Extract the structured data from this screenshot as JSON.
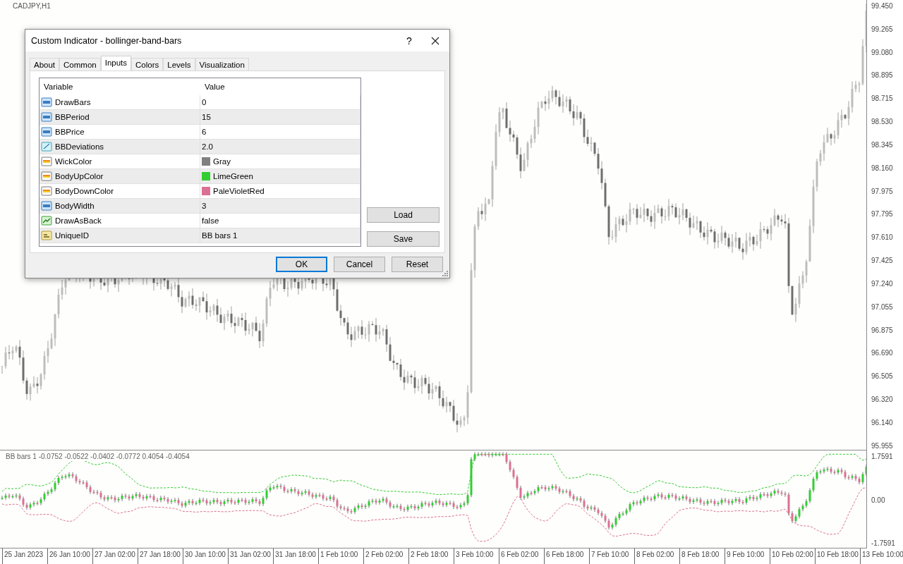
{
  "chart": {
    "symbol": "CADJPY,H1",
    "price_axis": [
      "99.450",
      "99.265",
      "99.080",
      "98.895",
      "98.715",
      "98.530",
      "98.345",
      "98.160",
      "97.975",
      "97.795",
      "97.610",
      "97.425",
      "97.240",
      "97.055",
      "96.875",
      "96.690",
      "96.505",
      "96.320",
      "96.140",
      "95.955"
    ],
    "indicator_label": "BB bars 1 -0.0752 -0.0522 -0.0402 -0.0772 0.4054 -0.4054",
    "indicator_axis": [
      "1.7591",
      "0.00",
      "-1.7591"
    ],
    "time_axis": [
      "25 Jan 2023",
      "26 Jan 10:00",
      "27 Jan 02:00",
      "27 Jan 18:00",
      "30 Jan 10:00",
      "31 Jan 02:00",
      "31 Jan 18:00",
      "1 Feb 10:00",
      "2 Feb 02:00",
      "2 Feb 18:00",
      "3 Feb 10:00",
      "6 Feb 02:00",
      "6 Feb 18:00",
      "7 Feb 10:00",
      "8 Feb 02:00",
      "8 Feb 18:00",
      "9 Feb 10:00",
      "10 Feb 02:00",
      "10 Feb 18:00",
      "13 Feb 10:00"
    ]
  },
  "dialog": {
    "title": "Custom Indicator - bollinger-band-bars",
    "help": "?",
    "tabs": [
      {
        "label": "About",
        "selected": false
      },
      {
        "label": "Common",
        "selected": false
      },
      {
        "label": "Inputs",
        "selected": true
      },
      {
        "label": "Colors",
        "selected": false
      },
      {
        "label": "Levels",
        "selected": false
      },
      {
        "label": "Visualization",
        "selected": false
      }
    ],
    "columns": [
      "Variable",
      "Value"
    ],
    "rows": [
      {
        "kind": "int",
        "name": "DrawBars",
        "value": "0"
      },
      {
        "kind": "int",
        "name": "BBPeriod",
        "value": "15"
      },
      {
        "kind": "int",
        "name": "BBPrice",
        "value": "6"
      },
      {
        "kind": "double",
        "name": "BBDeviations",
        "value": "2.0"
      },
      {
        "kind": "color",
        "name": "WickColor",
        "value": "Gray",
        "color": "#808080"
      },
      {
        "kind": "color",
        "name": "BodyUpColor",
        "value": "LimeGreen",
        "color": "#32cd32"
      },
      {
        "kind": "color",
        "name": "BodyDownColor",
        "value": "PaleVioletRed",
        "color": "#db7093"
      },
      {
        "kind": "int",
        "name": "BodyWidth",
        "value": "3"
      },
      {
        "kind": "bool",
        "name": "DrawAsBack",
        "value": "false"
      },
      {
        "kind": "string",
        "name": "UniqueID",
        "value": "BB bars 1"
      }
    ],
    "side_buttons": [
      "Load",
      "Save"
    ],
    "buttons": [
      {
        "label": "OK",
        "default": true
      },
      {
        "label": "Cancel",
        "default": false
      },
      {
        "label": "Reset",
        "default": false
      }
    ]
  }
}
